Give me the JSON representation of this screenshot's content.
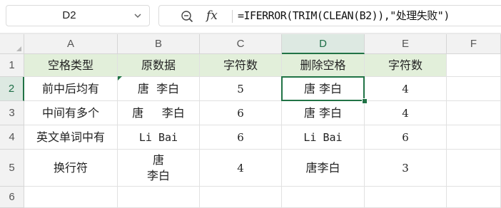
{
  "name_box": {
    "value": "D2"
  },
  "formula_bar": {
    "zoom_icon": "zoom-icon",
    "fx_label": "fx",
    "formula": "=IFERROR(TRIM(CLEAN(B2)),\"处理失败\")"
  },
  "columns": [
    "A",
    "B",
    "C",
    "D",
    "E",
    "F"
  ],
  "rows": [
    "1",
    "2",
    "3",
    "4",
    "5",
    "6"
  ],
  "cells": {
    "header": [
      "空格类型",
      "原数据",
      "字符数",
      "删除空格",
      "字符数"
    ],
    "r2": [
      "前中后均有",
      " 唐  李白 ",
      "5",
      "唐 李白",
      "4"
    ],
    "r3": [
      "中间有多个",
      "唐     李白",
      "6",
      "唐 李白",
      "4"
    ],
    "r4": [
      "英文单词中有",
      "Li Bai",
      "6",
      "Li Bai",
      "6"
    ],
    "r5": [
      "换行符",
      "唐\n李白",
      "4",
      "唐李白",
      "3"
    ]
  },
  "colors": {
    "header_fill": "#e2efda",
    "selection": "#217346"
  },
  "active_cell": "D2"
}
